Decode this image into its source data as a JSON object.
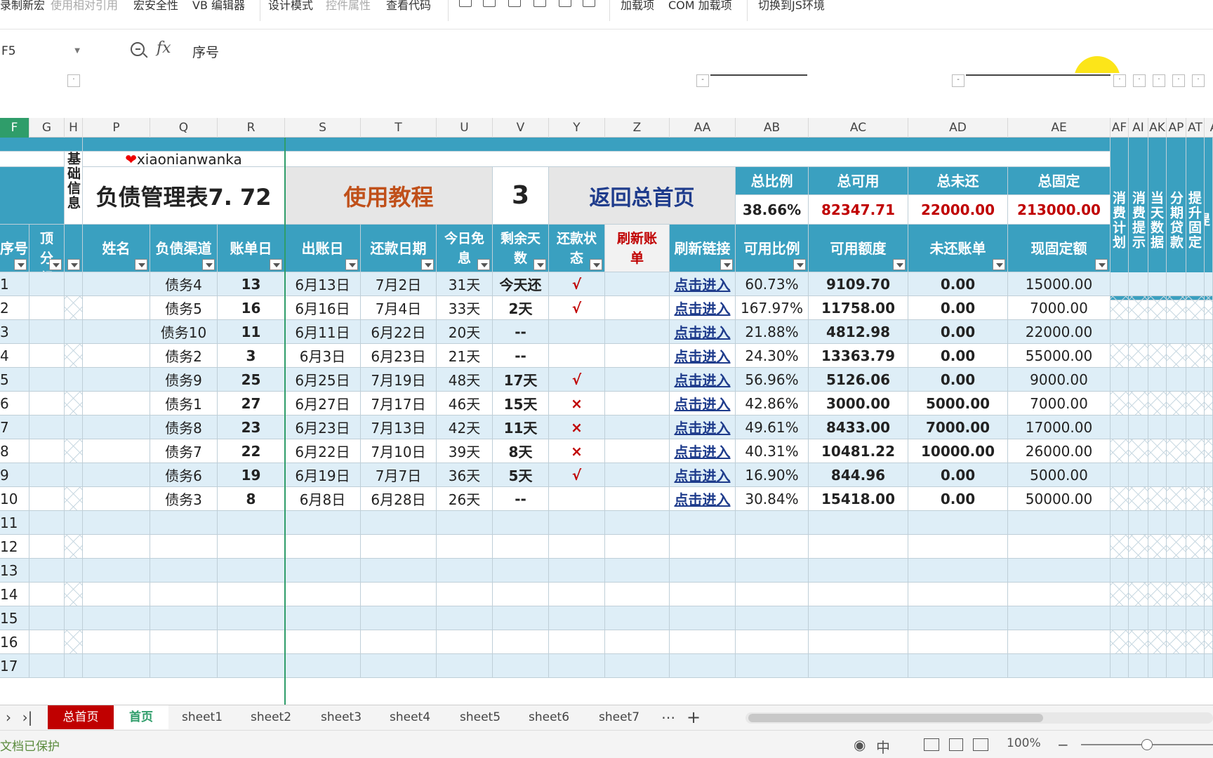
{
  "ribbon": {
    "items": [
      "录制新宏",
      "使用相对引用",
      "宏安全性",
      "VB 编辑器",
      "设计模式",
      "控件属性",
      "查看代码",
      "加载项",
      "COM 加载项",
      "切换到JS环境"
    ]
  },
  "formula_bar": {
    "cell_ref": "F5",
    "fx_label": "fx",
    "content": "序号"
  },
  "outline_buttons": [
    "-",
    "-"
  ],
  "columns": [
    "F",
    "G",
    "H",
    "P",
    "Q",
    "R",
    "S",
    "T",
    "U",
    "V",
    "Y",
    "Z",
    "AA",
    "AB",
    "AC",
    "AD",
    "AE",
    "AF",
    "AI",
    "AK",
    "AP",
    "AT",
    "A"
  ],
  "banner": {
    "heart": "❤",
    "user": "xiaonianwanka",
    "title": "负债管理表7. 72",
    "side_info": "基础信息",
    "tutorial": "使用教程",
    "count": "3",
    "home_link": "返回总首页"
  },
  "summary": {
    "labels": [
      "总比例",
      "总可用",
      "总未还",
      "总固定"
    ],
    "values": [
      "38.66%",
      "82347.71",
      "22000.00",
      "213000.00"
    ]
  },
  "right_headers": [
    "消费计划",
    "消费提示",
    "当天数据",
    "分期贷款",
    "提升固定",
    "提"
  ],
  "headers": [
    "序号",
    "置顶分组",
    "",
    "姓名",
    "负债渠道",
    "账单日",
    "出账日",
    "还款日期",
    "今日免息",
    "剩余天数",
    "还款状态",
    "刷新账单",
    "刷新链接",
    "可用比例",
    "可用额度",
    "未还账单",
    "现固定额"
  ],
  "rows": [
    {
      "no": "1",
      "channel": "债务4",
      "billday": "13",
      "out": "6月13日",
      "due": "7月2日",
      "free": "31天",
      "remain": "今天还",
      "status": "√",
      "link": "点击进入",
      "ratio": "60.73%",
      "avail": "9109.70",
      "unpaid": "0.00",
      "fixed": "15000.00"
    },
    {
      "no": "2",
      "channel": "债务5",
      "billday": "16",
      "out": "6月16日",
      "due": "7月4日",
      "free": "33天",
      "remain": "2天",
      "status": "√",
      "link": "点击进入",
      "ratio": "167.97%",
      "avail": "11758.00",
      "unpaid": "0.00",
      "fixed": "7000.00"
    },
    {
      "no": "3",
      "channel": "债务10",
      "billday": "11",
      "out": "6月11日",
      "due": "6月22日",
      "free": "20天",
      "remain": "--",
      "status": "",
      "link": "点击进入",
      "ratio": "21.88%",
      "avail": "4812.98",
      "unpaid": "0.00",
      "fixed": "22000.00"
    },
    {
      "no": "4",
      "channel": "债务2",
      "billday": "3",
      "out": "6月3日",
      "due": "6月23日",
      "free": "21天",
      "remain": "--",
      "status": "",
      "link": "点击进入",
      "ratio": "24.30%",
      "avail": "13363.79",
      "unpaid": "0.00",
      "fixed": "55000.00"
    },
    {
      "no": "5",
      "channel": "债务9",
      "billday": "25",
      "out": "6月25日",
      "due": "7月19日",
      "free": "48天",
      "remain": "17天",
      "status": "√",
      "link": "点击进入",
      "ratio": "56.96%",
      "avail": "5126.06",
      "unpaid": "0.00",
      "fixed": "9000.00"
    },
    {
      "no": "6",
      "channel": "债务1",
      "billday": "27",
      "out": "6月27日",
      "due": "7月17日",
      "free": "46天",
      "remain": "15天",
      "status": "×",
      "link": "点击进入",
      "ratio": "42.86%",
      "avail": "3000.00",
      "unpaid": "5000.00",
      "fixed": "7000.00"
    },
    {
      "no": "7",
      "channel": "债务8",
      "billday": "23",
      "out": "6月23日",
      "due": "7月13日",
      "free": "42天",
      "remain": "11天",
      "status": "×",
      "link": "点击进入",
      "ratio": "49.61%",
      "avail": "8433.00",
      "unpaid": "7000.00",
      "fixed": "17000.00"
    },
    {
      "no": "8",
      "channel": "债务7",
      "billday": "22",
      "out": "6月22日",
      "due": "7月10日",
      "free": "39天",
      "remain": "8天",
      "status": "×",
      "link": "点击进入",
      "ratio": "40.31%",
      "avail": "10481.22",
      "unpaid": "10000.00",
      "fixed": "26000.00"
    },
    {
      "no": "9",
      "channel": "债务6",
      "billday": "19",
      "out": "6月19日",
      "due": "7月7日",
      "free": "36天",
      "remain": "5天",
      "status": "√",
      "link": "点击进入",
      "ratio": "16.90%",
      "avail": "844.96",
      "unpaid": "0.00",
      "fixed": "5000.00"
    },
    {
      "no": "10",
      "channel": "债务3",
      "billday": "8",
      "out": "6月8日",
      "due": "6月28日",
      "free": "26天",
      "remain": "--",
      "status": "",
      "link": "点击进入",
      "ratio": "30.84%",
      "avail": "15418.00",
      "unpaid": "0.00",
      "fixed": "50000.00"
    }
  ],
  "empty_rows": [
    "11",
    "12",
    "13",
    "14",
    "15",
    "16",
    "17"
  ],
  "tabs": [
    "总首页",
    "首页",
    "sheet1",
    "sheet2",
    "sheet3",
    "sheet4",
    "sheet5",
    "sheet6",
    "sheet7"
  ],
  "tab_more": "⋯",
  "tab_add": "+",
  "status": {
    "protected": "文档已保护",
    "zoom": "100%",
    "zoom_minus": "−"
  },
  "colors": {
    "header_blue": "#3aa0c0",
    "row_stripe": "#deeef7",
    "red": "#c00000",
    "active_tab": "#2f9d6a"
  }
}
